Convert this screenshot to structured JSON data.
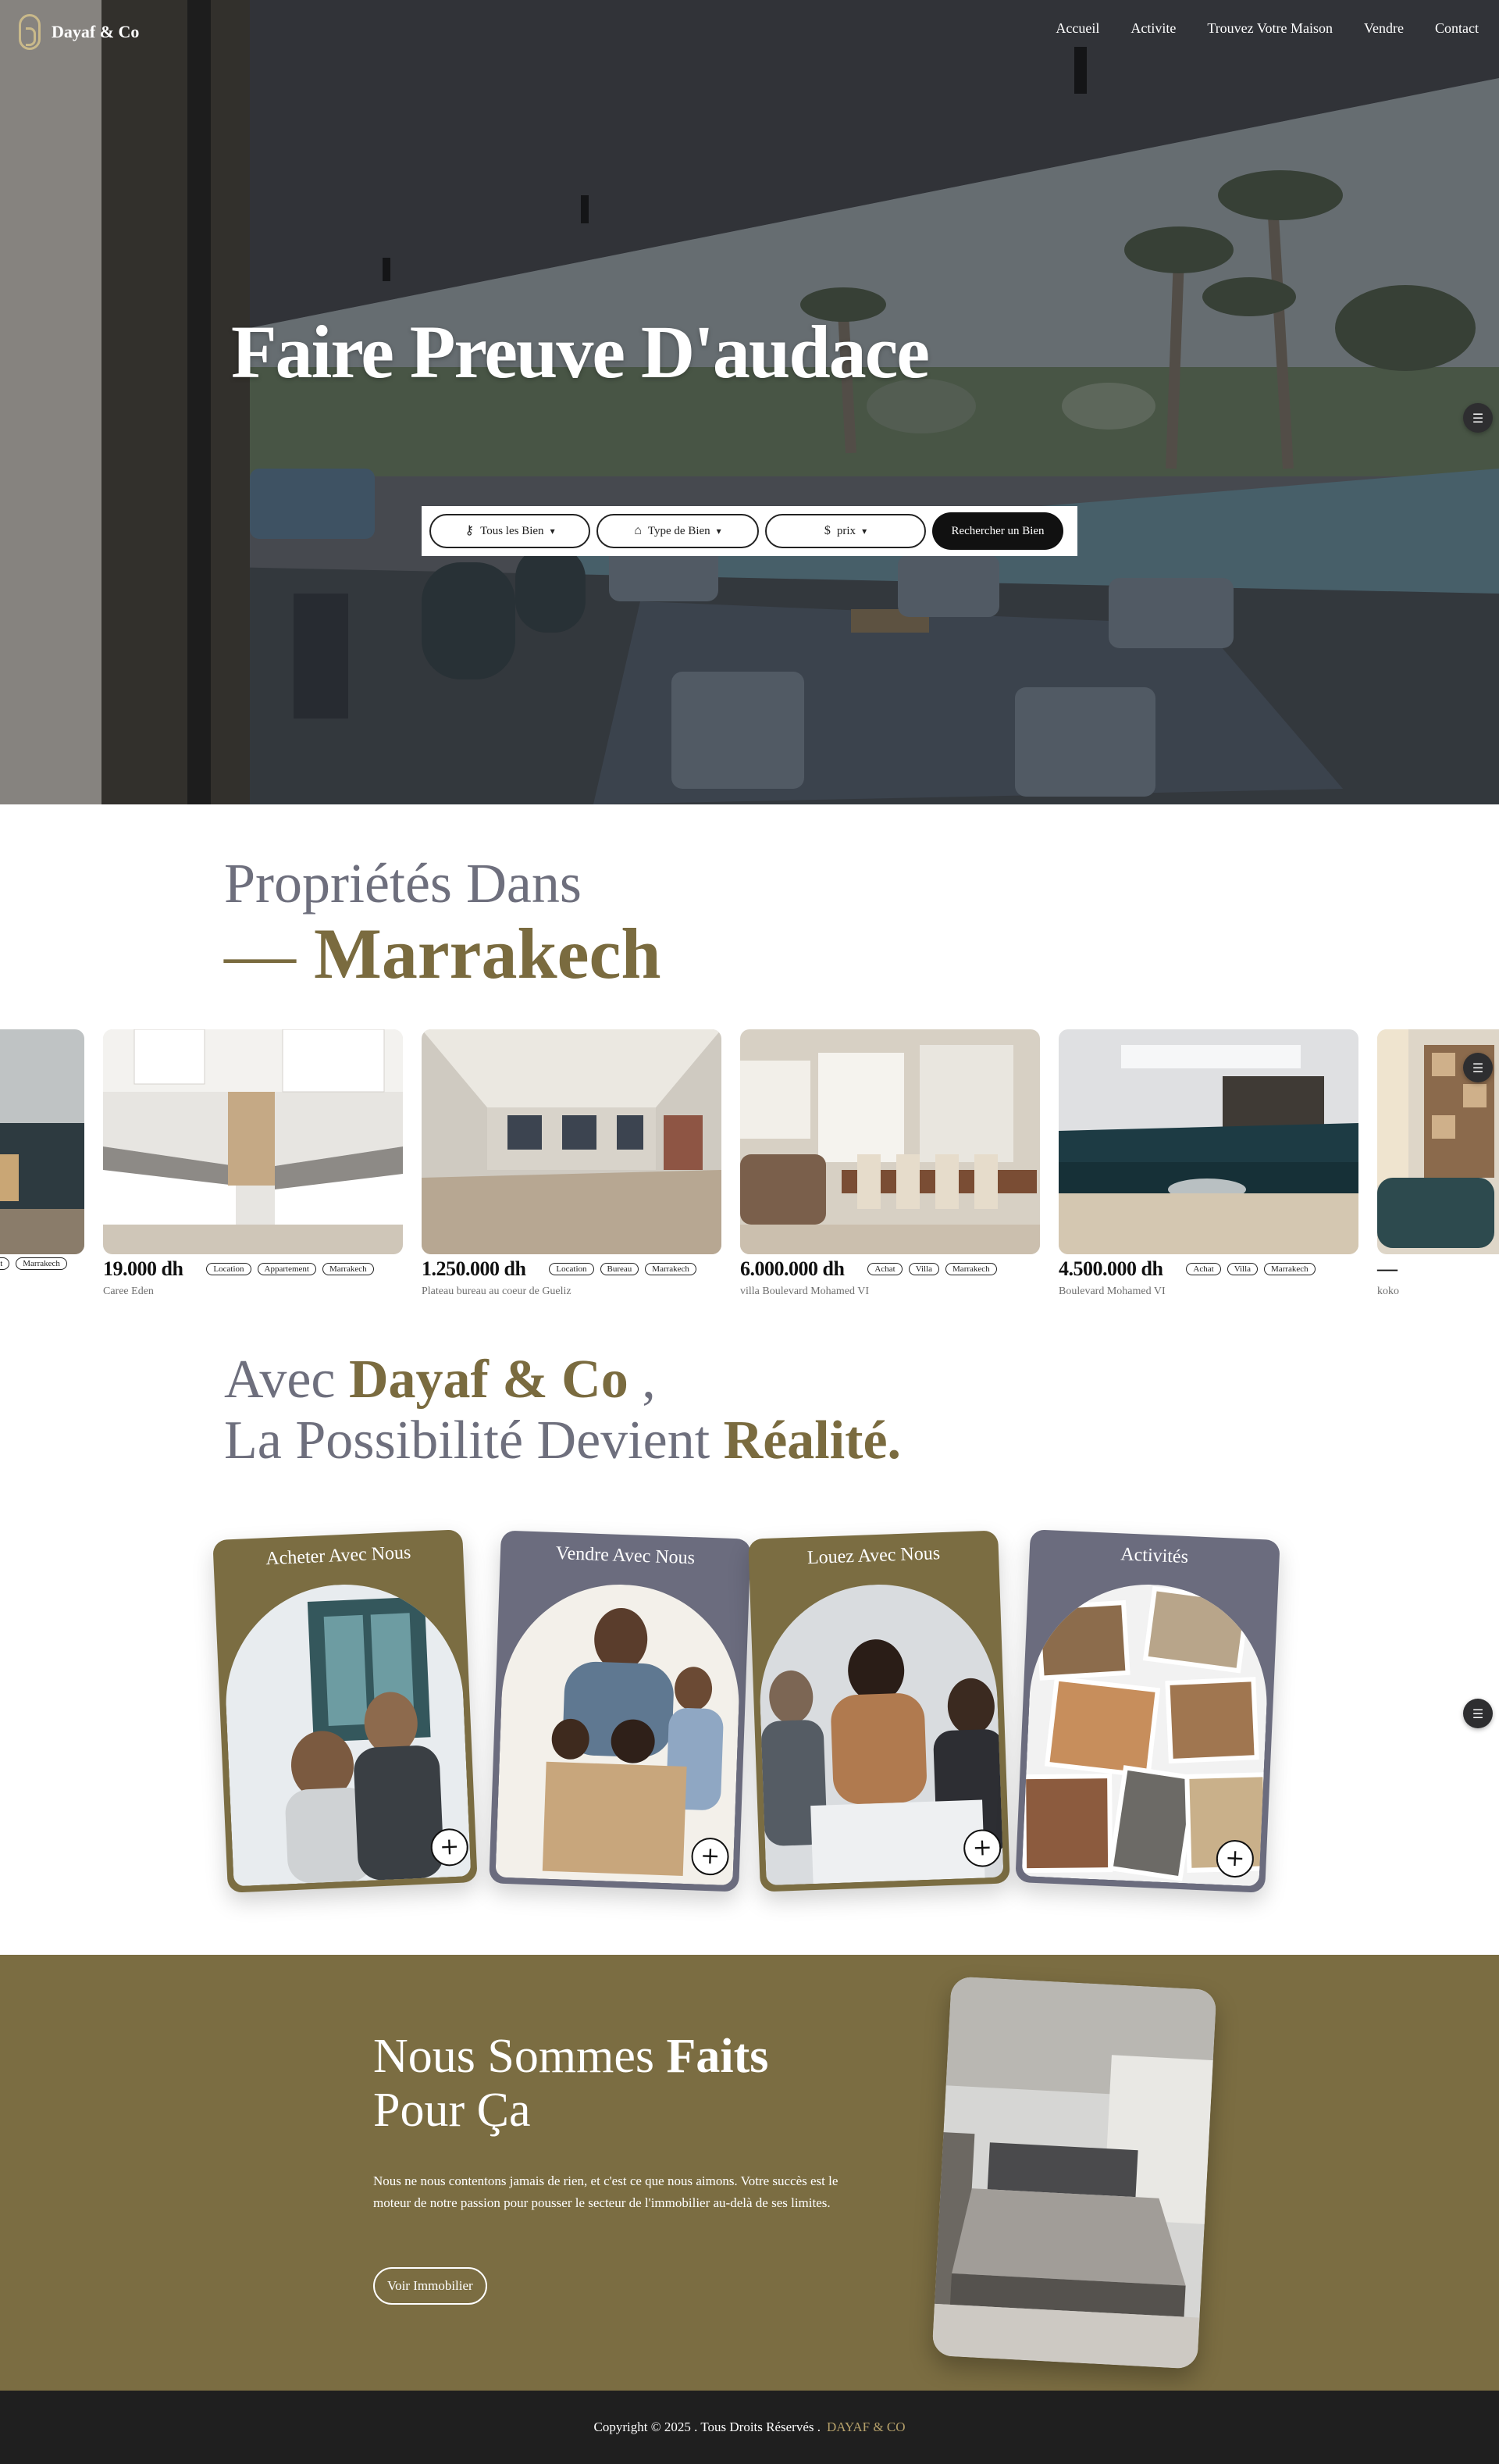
{
  "brand": {
    "name": "Dayaf & Co"
  },
  "nav": {
    "items": [
      "Accueil",
      "Activite",
      "Trouvez Votre Maison",
      "Vendre",
      "Contact"
    ]
  },
  "hero": {
    "title": "Faire Preuve D'audace"
  },
  "search": {
    "filters": [
      {
        "label": "Tous les Bien",
        "icon": "key-icon"
      },
      {
        "label": "Type de Bien",
        "icon": "house-icon"
      },
      {
        "label": "prix",
        "icon": "dollar-icon"
      }
    ],
    "submit_label": "Rechercher un Bien"
  },
  "properties": {
    "title_line1": "Propriétés Dans",
    "title_dash": "—",
    "title_city": "Marrakech",
    "items": [
      {
        "price": "",
        "tags": [
          "Achat",
          "Marrakech"
        ],
        "address": ""
      },
      {
        "price": "19.000 dh",
        "tags": [
          "Location",
          "Appartement",
          "Marrakech"
        ],
        "address": "Caree Eden"
      },
      {
        "price": "1.250.000 dh",
        "tags": [
          "Location",
          "Bureau",
          "Marrakech"
        ],
        "address": "Plateau bureau au coeur de Gueliz"
      },
      {
        "price": "6.000.000 dh",
        "tags": [
          "Achat",
          "Villa",
          "Marrakech"
        ],
        "address": "villa Boulevard Mohamed VI"
      },
      {
        "price": "4.500.000 dh",
        "tags": [
          "Achat",
          "Villa",
          "Marrakech"
        ],
        "address": "Boulevard Mohamed VI"
      },
      {
        "price": "—",
        "tags": [],
        "address": "koko"
      }
    ]
  },
  "avec": {
    "line1_pre": "Avec",
    "line1_brand": "Dayaf & Co",
    "line1_post": " ,",
    "line2_pre": "La Possibilité Devient",
    "line2_emph": "Réalité."
  },
  "services": [
    {
      "title": "Acheter Avec Nous",
      "color": "#7b6d42"
    },
    {
      "title": "Vendre Avec Nous",
      "color": "#6b6c7e"
    },
    {
      "title": "Louez Avec Nous",
      "color": "#7b6d42"
    },
    {
      "title": "Activités",
      "color": "#6b6c7e"
    }
  ],
  "faits": {
    "title_pre": "Nous Sommes",
    "title_emph": "Faits",
    "title_line2": "Pour Ça",
    "text": "Nous ne nous contentons jamais de rien, et c'est ce que nous aimons. Votre succès est le moteur de notre passion pour pousser le secteur de l'immobilier au-delà de ses limites.",
    "button": "Voir Immobilier"
  },
  "footer": {
    "copyright": "Copyright © 2025 . Tous Droits Réservés .",
    "brand": "DAYAF & CO"
  },
  "colors": {
    "gold": "#7b6d42",
    "slate": "#6b6c7e",
    "dark": "#1f1f1f"
  }
}
